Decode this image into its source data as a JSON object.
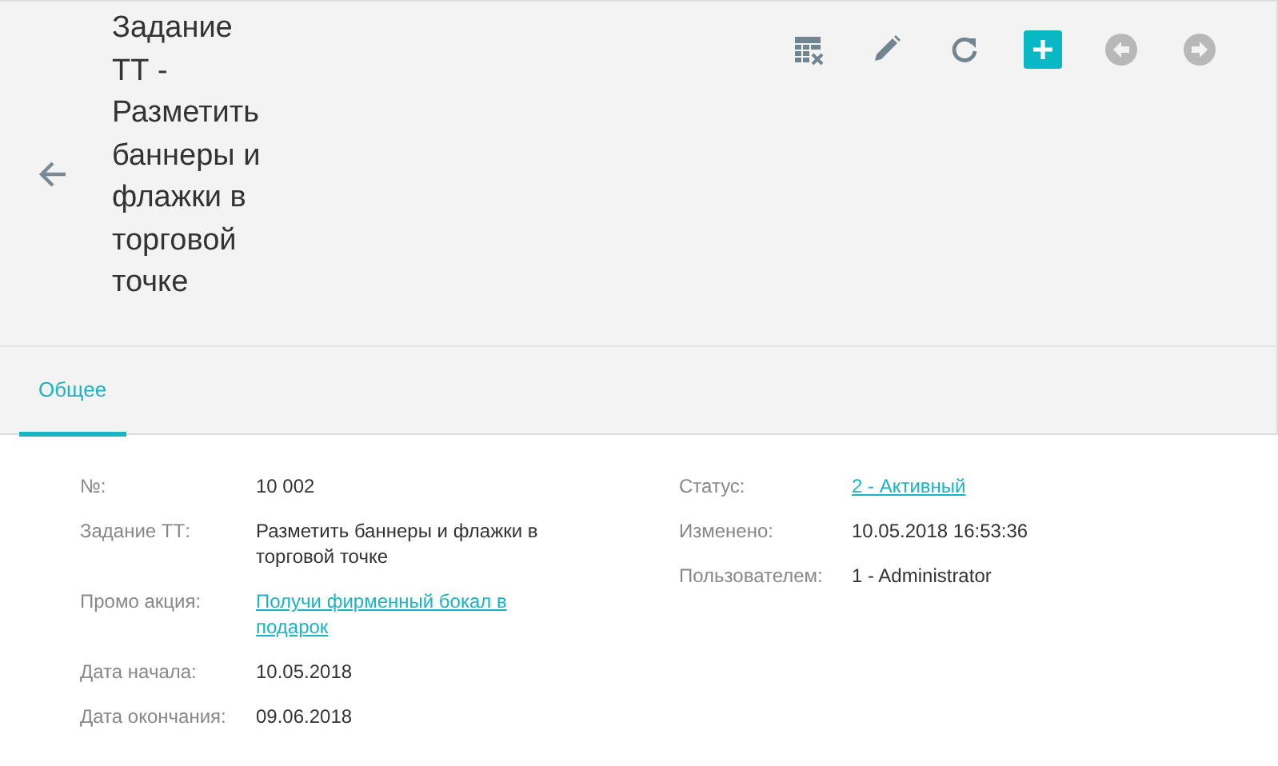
{
  "header": {
    "title": "Задание ТТ - Разметить баннеры и флажки в торговой точке",
    "toolbar": [
      {
        "kind": "table-clear",
        "disabled": false
      },
      {
        "kind": "edit",
        "disabled": false
      },
      {
        "kind": "refresh",
        "disabled": false
      },
      {
        "kind": "add",
        "disabled": false
      },
      {
        "kind": "prev",
        "disabled": true
      },
      {
        "kind": "next",
        "disabled": true
      }
    ]
  },
  "tabs": [
    {
      "label": "Общее",
      "selected": true
    }
  ],
  "fields_left": [
    {
      "label": "№:",
      "value": "10 002",
      "kind": "text"
    },
    {
      "label": "Задание ТТ:",
      "value": "Разметить баннеры и флажки в торговой точке",
      "kind": "text"
    },
    {
      "label": "Промо акция:",
      "value": "Получи фирменный бокал в подарок",
      "kind": "link"
    },
    {
      "label": "Дата начала:",
      "value": "10.05.2018",
      "kind": "text"
    },
    {
      "label": "Дата окончания:",
      "value": "09.06.2018",
      "kind": "text"
    }
  ],
  "fields_right": [
    {
      "label": "Статус:",
      "value": "2 - Активный",
      "kind": "link"
    },
    {
      "label": "Изменено:",
      "value": "10.05.2018 16:53:36",
      "kind": "text"
    },
    {
      "label": "Пользователем:",
      "value": "1 - Administrator",
      "kind": "text"
    }
  ]
}
